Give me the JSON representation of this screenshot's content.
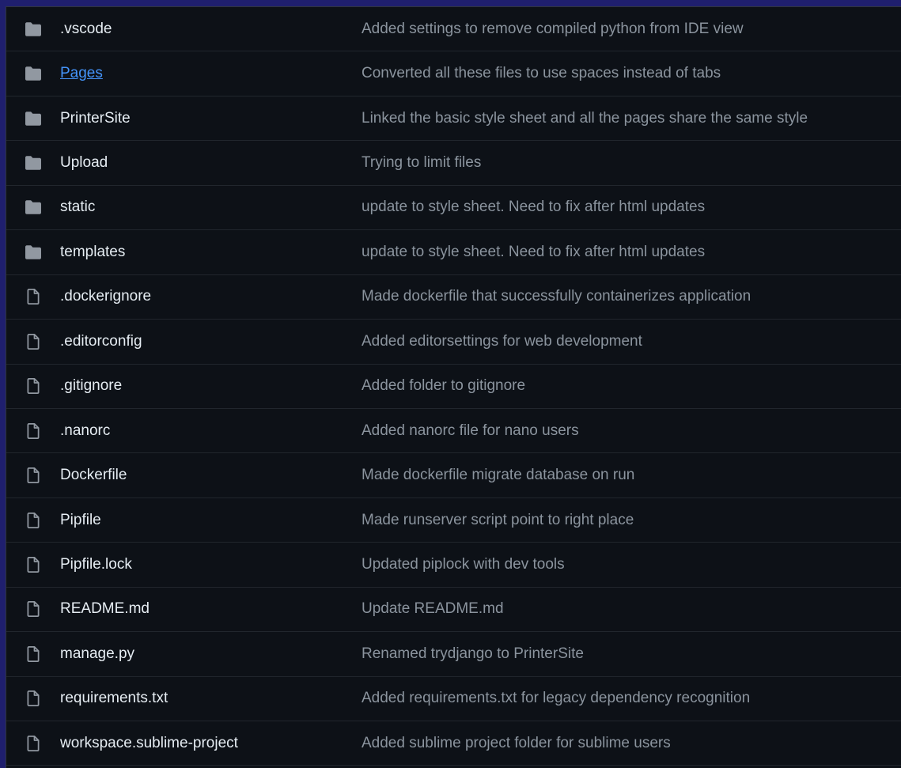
{
  "colors": {
    "background": "#0d1117",
    "outer": "#1f1f6e",
    "row_border": "#21262d",
    "name_text": "#e6edf3",
    "link_text": "#4493f8",
    "message_text": "#8b949e",
    "icon": "#9198a1"
  },
  "files": [
    {
      "type": "folder",
      "icon": "folder-icon",
      "name": ".vscode",
      "message": "Added settings to remove compiled python from IDE view"
    },
    {
      "type": "folder",
      "icon": "folder-icon",
      "name": "Pages",
      "message": "Converted all these files to use spaces instead of tabs",
      "highlighted": true
    },
    {
      "type": "folder",
      "icon": "folder-icon",
      "name": "PrinterSite",
      "message": "Linked the basic style sheet and all the pages share the same style"
    },
    {
      "type": "folder",
      "icon": "folder-icon",
      "name": "Upload",
      "message": "Trying to limit files"
    },
    {
      "type": "folder",
      "icon": "folder-icon",
      "name": "static",
      "message": "update to style sheet. Need to fix after html updates"
    },
    {
      "type": "folder",
      "icon": "folder-icon",
      "name": "templates",
      "message": "update to style sheet. Need to fix after html updates"
    },
    {
      "type": "file",
      "icon": "file-icon",
      "name": ".dockerignore",
      "message": "Made dockerfile that successfully containerizes application"
    },
    {
      "type": "file",
      "icon": "file-icon",
      "name": ".editorconfig",
      "message": "Added editorsettings for web development"
    },
    {
      "type": "file",
      "icon": "file-icon",
      "name": ".gitignore",
      "message": "Added folder to gitignore"
    },
    {
      "type": "file",
      "icon": "file-icon",
      "name": ".nanorc",
      "message": "Added nanorc file for nano users"
    },
    {
      "type": "file",
      "icon": "file-icon",
      "name": "Dockerfile",
      "message": "Made dockerfile migrate database on run"
    },
    {
      "type": "file",
      "icon": "file-icon",
      "name": "Pipfile",
      "message": "Made runserver script point to right place"
    },
    {
      "type": "file",
      "icon": "file-icon",
      "name": "Pipfile.lock",
      "message": "Updated piplock with dev tools"
    },
    {
      "type": "file",
      "icon": "file-icon",
      "name": "README.md",
      "message": "Update README.md"
    },
    {
      "type": "file",
      "icon": "file-icon",
      "name": "manage.py",
      "message": "Renamed trydjango to PrinterSite"
    },
    {
      "type": "file",
      "icon": "file-icon",
      "name": "requirements.txt",
      "message": "Added requirements.txt for legacy dependency recognition"
    },
    {
      "type": "file",
      "icon": "file-icon",
      "name": "workspace.sublime-project",
      "message": "Added sublime project folder for sublime users"
    }
  ]
}
